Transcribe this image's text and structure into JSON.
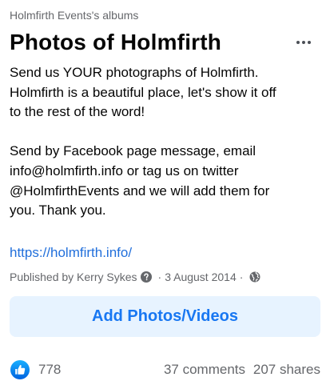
{
  "album_owner": "Holmfirth Events's albums",
  "page_title": "Photos of Holmfirth",
  "description": {
    "para1_line1": "Send us YOUR photographs of Holmfirth.",
    "para1_line2": "Holmfirth is a beautiful place, let's show it off",
    "para1_line3": "to the rest of the word!",
    "para2_line1": "Send by Facebook page message, email",
    "para2_line2": "info@holmfirth.info or tag us on twitter",
    "para2_line3": "@HolmfirthEvents and we will add them for",
    "para2_line4": "you. Thank you."
  },
  "link": "https://holmfirth.info/",
  "meta": {
    "published_by": "Published by Kerry Sykes",
    "separator": "·",
    "date": "3 August 2014",
    "separator2": "·"
  },
  "add_button_label": "Add Photos/Videos",
  "footer": {
    "likes": "778",
    "comments": "37 comments",
    "shares": "207 shares"
  },
  "colors": {
    "accent": "#1877f2",
    "button_bg": "#e7f3ff",
    "secondary_text": "#65676b",
    "link": "#216fdb"
  },
  "icons": [
    "more-icon",
    "question-icon",
    "globe-icon",
    "like-icon"
  ]
}
